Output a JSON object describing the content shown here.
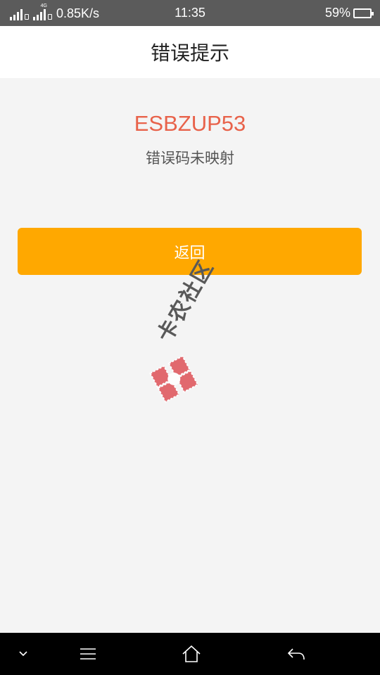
{
  "status": {
    "network_speed": "0.85K/s",
    "network_type": "4G",
    "time": "11:35",
    "battery": "59%",
    "battery_level": 0.59
  },
  "header": {
    "title": "错误提示"
  },
  "error": {
    "code": "ESBZUP53",
    "message": "错误码未映射"
  },
  "actions": {
    "back_label": "返回"
  },
  "watermark": {
    "text": "卡农社区"
  },
  "colors": {
    "accent": "#ffa800",
    "error": "#e8624a",
    "status_bar": "#5b5b5b"
  },
  "navbar": {
    "icons": [
      "chevron-down-icon",
      "menu-icon",
      "home-icon",
      "back-icon"
    ]
  }
}
